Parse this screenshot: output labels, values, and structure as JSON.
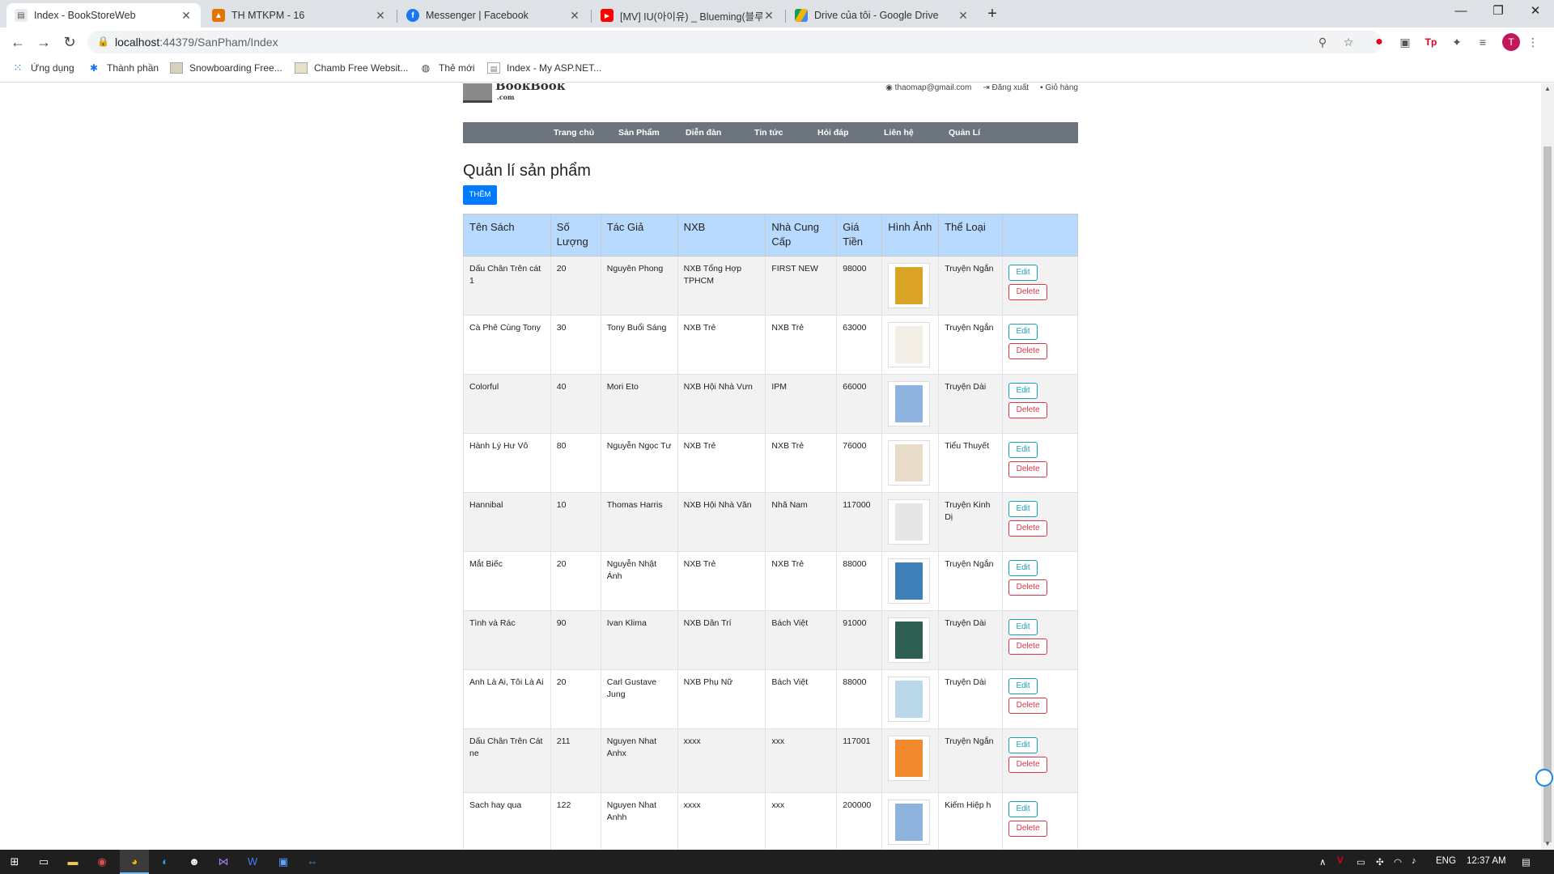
{
  "browser": {
    "tabs": [
      {
        "title": "Index - BookStoreWeb",
        "icon": "page-icon",
        "active": true
      },
      {
        "title": "TH MTKPM - 16",
        "icon": "classroom-icon",
        "active": false
      },
      {
        "title": "Messenger | Facebook",
        "icon": "facebook-icon",
        "active": false
      },
      {
        "title": "[MV] IU(아이유) _ Blueming(블루",
        "icon": "youtube-icon",
        "active": false
      },
      {
        "title": "Drive của tôi - Google Drive",
        "icon": "drive-icon",
        "active": false
      }
    ],
    "new_tab": "+",
    "window_controls": {
      "minimize": "—",
      "restore": "❐",
      "close": "✕"
    },
    "url_host": "localhost",
    "url_path": ":44379/SanPham/Index",
    "profile_initial": "T",
    "bookmarks": [
      {
        "label": "Ứng dụng",
        "icon": "apps-grid-icon"
      },
      {
        "label": "Thành phần",
        "icon": "puzzle-icon"
      },
      {
        "label": "Snowboarding Free...",
        "icon": "page-icon"
      },
      {
        "label": "Chamb Free Websit...",
        "icon": "page-icon"
      },
      {
        "label": "Thẻ mới",
        "icon": "globe-icon"
      },
      {
        "label": "Index - My ASP.NET...",
        "icon": "page-icon"
      }
    ]
  },
  "site": {
    "logo_text": "BookBook",
    "logo_sub": ".com",
    "user_email": "thaomap@gmail.com",
    "logout": "Đăng xuất",
    "cart": "Giỏ hàng",
    "nav": [
      "Trang chủ",
      "Sản Phẩm",
      "Diễn đàn",
      "Tin tức",
      "Hỏi đáp",
      "Liên hệ",
      "Quản Lí"
    ]
  },
  "page": {
    "title": "Quản lí sản phẩm",
    "add_button": "THÊM",
    "columns": [
      "Tên Sách",
      "Số Lượng",
      "Tác Giả",
      "NXB",
      "Nhà Cung Cấp",
      "Giá Tiền",
      "Hình Ảnh",
      "Thể Loại",
      ""
    ],
    "edit_label": "Edit",
    "delete_label": "Delete",
    "rows": [
      {
        "ten": "Dấu Chân Trên cát 1",
        "sl": "20",
        "tacgia": "Nguyên Phong",
        "nxb": "NXB Tổng Hợp TPHCM",
        "ncc": "FIRST NEW",
        "gia": "98000",
        "loai": "Truyện Ngắn",
        "cover": "#d9a426"
      },
      {
        "ten": "Cà Phê Cùng Tony",
        "sl": "30",
        "tacgia": "Tony Buổi Sáng",
        "nxb": "NXB Trẻ",
        "ncc": "NXB Trẻ",
        "gia": "63000",
        "loai": "Truyện Ngắn",
        "cover": "#f4efe6"
      },
      {
        "ten": "Colorful",
        "sl": "40",
        "tacgia": "Mori Eto",
        "nxb": "NXB Hội Nhà Vưn",
        "ncc": "IPM",
        "gia": "66000",
        "loai": "Truyện Dài",
        "cover": "#8fb3df"
      },
      {
        "ten": "Hành Lý Hư Vô",
        "sl": "80",
        "tacgia": "Nguyễn Ngọc Tư",
        "nxb": "NXB Trẻ",
        "ncc": "NXB Trẻ",
        "gia": "76000",
        "loai": "Tiểu Thuyết",
        "cover": "#e8dcc8"
      },
      {
        "ten": "Hannibal",
        "sl": "10",
        "tacgia": "Thomas Harris",
        "nxb": "NXB Hội Nhà Văn",
        "ncc": "Nhã Nam",
        "gia": "117000",
        "loai": "Truyện Kinh Dị",
        "cover": "#e6e6e6"
      },
      {
        "ten": "Mắt Biếc",
        "sl": "20",
        "tacgia": "Nguyễn Nhật Ánh",
        "nxb": "NXB Trẻ",
        "ncc": "NXB Trẻ",
        "gia": "88000",
        "loai": "Truyện Ngắn",
        "cover": "#3f7fb8"
      },
      {
        "ten": "Tình và Rác",
        "sl": "90",
        "tacgia": "Ivan Klima",
        "nxb": "NXB Dân Trí",
        "ncc": "Bách Việt",
        "gia": "91000",
        "loai": "Truyện Dài",
        "cover": "#2f5f52"
      },
      {
        "ten": "Anh Là Ai, Tôi Là Ai",
        "sl": "20",
        "tacgia": "Carl Gustave Jung",
        "nxb": "NXB Phụ Nữ",
        "ncc": "Bách Việt",
        "gia": "88000",
        "loai": "Truyện Dài",
        "cover": "#b9d9ea"
      },
      {
        "ten": "Dấu Chân Trên Cát ne",
        "sl": "211",
        "tacgia": "Nguyen Nhat Anhx",
        "nxb": "xxxx",
        "ncc": "xxx",
        "gia": "117001",
        "loai": "Truyện Ngắn",
        "cover": "#f08a2c"
      },
      {
        "ten": "Sach hay qua",
        "sl": "122",
        "tacgia": "Nguyen Nhat Anhh",
        "nxb": "xxxx",
        "ncc": "xxx",
        "gia": "200000",
        "loai": "Kiếm Hiệp h",
        "cover": "#8fb3df"
      }
    ]
  },
  "taskbar": {
    "lang": "ENG",
    "time": "12:37 AM"
  }
}
